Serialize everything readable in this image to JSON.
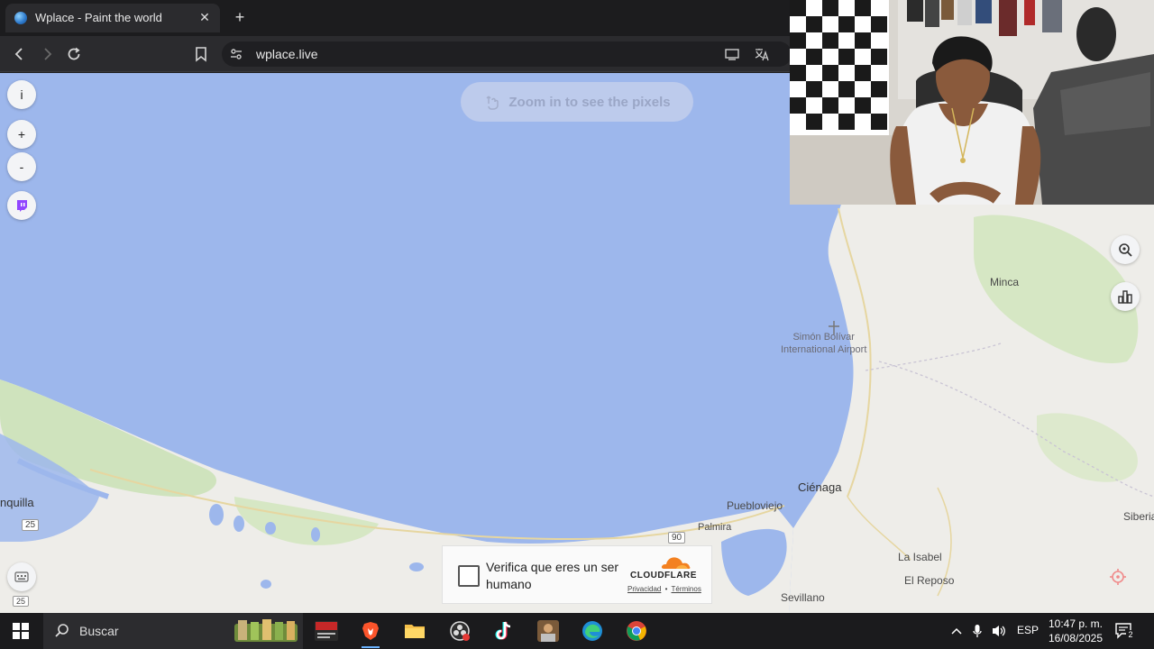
{
  "browser": {
    "tab_title": "Wplace - Paint the world",
    "tab_close": "✕",
    "new_tab": "+",
    "url": "wplace.live"
  },
  "map": {
    "left_buttons": [
      {
        "name": "info-button",
        "label": "i"
      },
      {
        "name": "zoom-in-button",
        "label": "+"
      },
      {
        "name": "zoom-out-button",
        "label": "-"
      }
    ],
    "zoom_hint": "Zoom in to see the pixels",
    "places": {
      "minca": "Minca",
      "airport_line1": "Simón Bolívar",
      "airport_line2": "International Airport",
      "cienaga": "Ciénaga",
      "puebloviejo": "Puebloviejo",
      "palmira": "Palmira",
      "barranquilla_partial": "nquilla",
      "siberia": "Siberia",
      "la_isabel": "La Isabel",
      "el_reposo": "El Reposo",
      "sevillano": "Sevillano"
    },
    "road_shields": {
      "r25": "25",
      "r90": "90",
      "r25b": "25"
    }
  },
  "captcha": {
    "label": "Verifica que eres un ser humano",
    "brand": "CLOUDFLARE",
    "privacy": "Privacidad",
    "separator": "•",
    "terms": "Términos"
  },
  "taskbar": {
    "search_placeholder": "Buscar",
    "language": "ESP",
    "time": "10:47 p. m.",
    "date": "16/08/2025",
    "notification_count": "2"
  },
  "colors": {
    "water": "#9db7ec",
    "land": "#eeede9",
    "vegetation": "#d6e7c4",
    "accent": "#f38020"
  }
}
